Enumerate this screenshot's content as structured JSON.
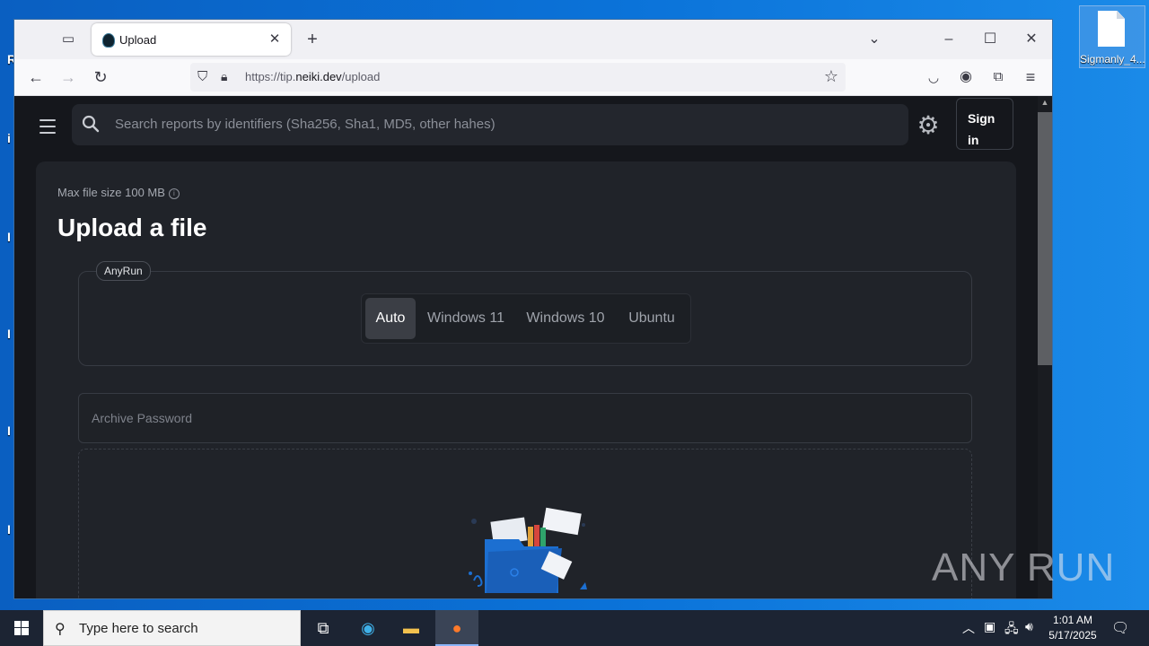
{
  "desktop": {
    "file_icon_label": "Sigmanly_4...",
    "watermark": "ANY RUN"
  },
  "browser": {
    "tab": {
      "title": "Upload"
    },
    "url": {
      "prefix": "https://tip.",
      "domain": "neiki.dev",
      "path": "/upload"
    }
  },
  "page": {
    "search_placeholder": "Search reports by identifiers (Sha256, Sha1, MD5, other hahes)",
    "signin_line1": "Sign",
    "signin_line2": "in",
    "max_file_size": "Max file size 100 MB",
    "heading": "Upload a file",
    "provider_tag": "AnyRun",
    "os_options": [
      "Auto",
      "Windows 11",
      "Windows 10",
      "Ubuntu"
    ],
    "os_selected": "Auto",
    "archive_password_placeholder": "Archive Password"
  },
  "taskbar": {
    "search_placeholder": "Type here to search",
    "time": "1:01 AM",
    "date": "5/17/2025"
  },
  "colors": {
    "page_bg": "#15171c",
    "card_bg": "#202329",
    "accent_folder": "#1c6fd1"
  }
}
